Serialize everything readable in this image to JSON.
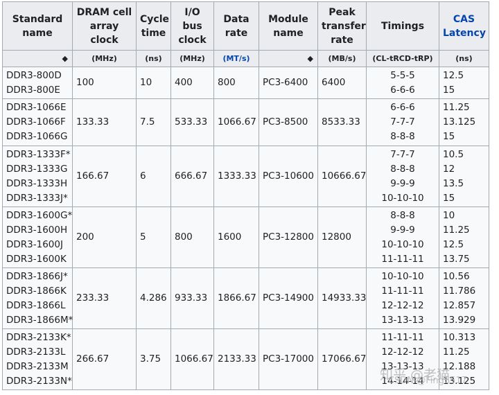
{
  "headers": [
    {
      "label": "Standard name",
      "unit": ""
    },
    {
      "label": "DRAM cell array clock",
      "unit": "(MHz)"
    },
    {
      "label": "Cycle time",
      "unit": "(ns)"
    },
    {
      "label": "I/O bus clock",
      "unit": "(MHz)"
    },
    {
      "label": "Data rate",
      "unit": "(MT/s)"
    },
    {
      "label": "Module name",
      "unit": ""
    },
    {
      "label": "Peak transfer rate",
      "unit": "(MB/s)"
    },
    {
      "label": "Timings",
      "unit": "(CL-tRCD-tRP)"
    },
    {
      "label": "CAS Latency",
      "unit": "(ns)"
    }
  ],
  "rows": [
    {
      "standard": [
        "DDR3-800D",
        "DDR3-800E"
      ],
      "clock": "100",
      "cycle": "10",
      "io": "400",
      "rate": "800",
      "module": "PC3-6400",
      "peak": "6400",
      "timings": [
        "5-5-5",
        "6-6-6"
      ],
      "cas": [
        "12.5",
        "15"
      ]
    },
    {
      "standard": [
        "DDR3-1066E",
        "DDR3-1066F",
        "DDR3-1066G"
      ],
      "clock": "133.33",
      "cycle": "7.5",
      "io": "533.33",
      "rate": "1066.67",
      "module": "PC3-8500",
      "peak": "8533.33",
      "timings": [
        "6-6-6",
        "7-7-7",
        "8-8-8"
      ],
      "cas": [
        "11.25",
        "13.125",
        "15"
      ]
    },
    {
      "standard": [
        "DDR3-1333F*",
        "DDR3-1333G",
        "DDR3-1333H",
        "DDR3-1333J*"
      ],
      "clock": "166.67",
      "cycle": "6",
      "io": "666.67",
      "rate": "1333.33",
      "module": "PC3-10600",
      "peak": "10666.67",
      "timings": [
        "7-7-7",
        "8-8-8",
        "9-9-9",
        "10-10-10"
      ],
      "cas": [
        "10.5",
        "12",
        "13.5",
        "15"
      ]
    },
    {
      "standard": [
        "DDR3-1600G*",
        "DDR3-1600H",
        "DDR3-1600J",
        "DDR3-1600K"
      ],
      "clock": "200",
      "cycle": "5",
      "io": "800",
      "rate": "1600",
      "module": "PC3-12800",
      "peak": "12800",
      "timings": [
        "8-8-8",
        "9-9-9",
        "10-10-10",
        "11-11-11"
      ],
      "cas": [
        "10",
        "11.25",
        "12.5",
        "13.75"
      ]
    },
    {
      "standard": [
        "DDR3-1866J*",
        "DDR3-1866K",
        "DDR3-1866L",
        "DDR3-1866M*"
      ],
      "clock": "233.33",
      "cycle": "4.286",
      "io": "933.33",
      "rate": "1866.67",
      "module": "PC3-14900",
      "peak": "14933.33",
      "timings": [
        "10-10-10",
        "11-11-11",
        "12-12-12",
        "13-13-13"
      ],
      "cas": [
        "10.56",
        "11.786",
        "12.857",
        "13.929"
      ]
    },
    {
      "standard": [
        "DDR3-2133K*",
        "DDR3-2133L",
        "DDR3-2133M",
        "DDR3-2133N*"
      ],
      "clock": "266.67",
      "cycle": "3.75",
      "io": "1066.67",
      "rate": "2133.33",
      "module": "PC3-17000",
      "peak": "17066.67",
      "timings": [
        "11-11-11",
        "12-12-12",
        "13-13-13",
        "14-14-14"
      ],
      "cas": [
        "10.313",
        "11.25",
        "12.188",
        "13.125"
      ]
    }
  ],
  "watermark": {
    "line1": "知乎 @老猫",
    "line2": "CSDN @Fing6517"
  },
  "colors": {
    "header_bg": "#eaecf0",
    "border": "#a2a9b1",
    "link": "#0645ad",
    "cell_bg": "#f8f9fa"
  }
}
